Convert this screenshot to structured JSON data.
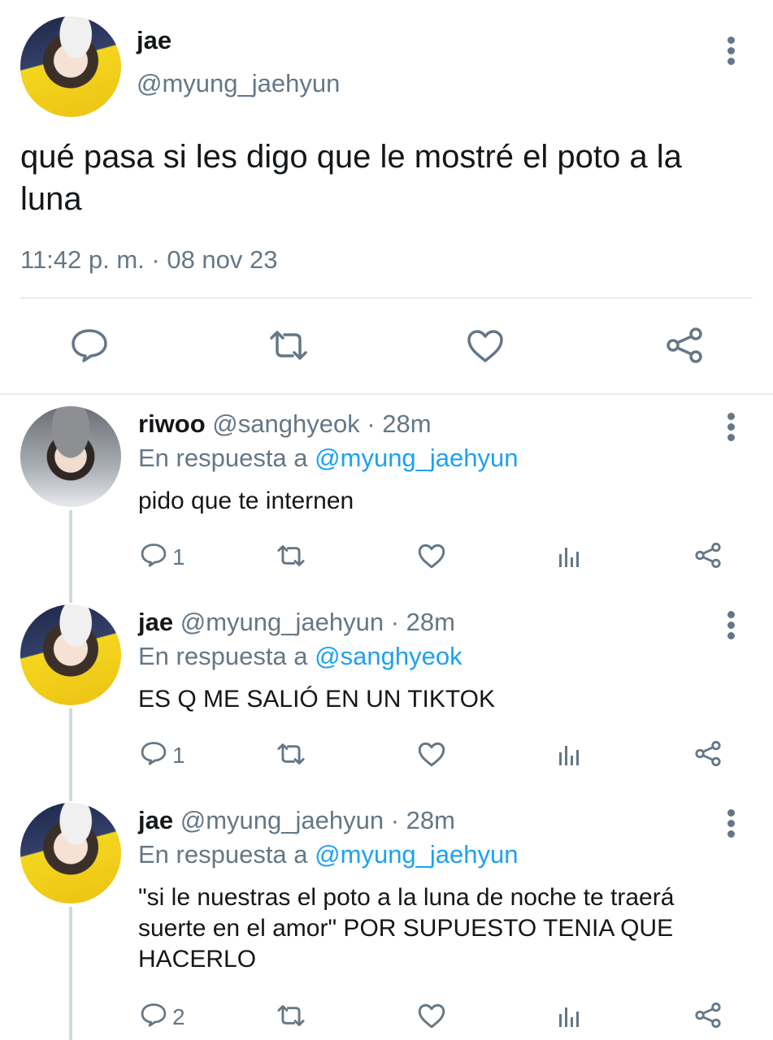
{
  "main_tweet": {
    "author_name": "jae",
    "author_handle": "@myung_jaehyun",
    "text_line1": "qué pasa si les digo que le mostré el poto a la",
    "text_line2": "luna",
    "timestamp": "11:42 p. m. · 08 nov 23"
  },
  "replies": [
    {
      "name": "riwoo",
      "handle_time": "@sanghyeok · 28m",
      "reply_prefix": "En respuesta a",
      "reply_to": "@myung_jaehyun",
      "lines": [
        "pido que te internen"
      ],
      "reply_count": "1"
    },
    {
      "name": "jae",
      "handle_time": "@myung_jaehyun · 28m",
      "reply_prefix": "En respuesta a",
      "reply_to": "@sanghyeok",
      "lines": [
        "ES Q ME SALIÓ EN UN TIKTOK"
      ],
      "reply_count": "1"
    },
    {
      "name": "jae",
      "handle_time": "@myung_jaehyun · 28m",
      "reply_prefix": "En respuesta a",
      "reply_to": "@myung_jaehyun",
      "lines": [
        "\"si le nuestras el poto a la luna de noche te traerá",
        "suerte en el amor\" POR SUPUESTO TENIA QUE",
        "HACERLO"
      ],
      "reply_count": "2"
    }
  ],
  "colors": {
    "text": "#14171a",
    "muted": "#657786",
    "link": "#1da1f2",
    "divider": "#e6ecf0"
  }
}
